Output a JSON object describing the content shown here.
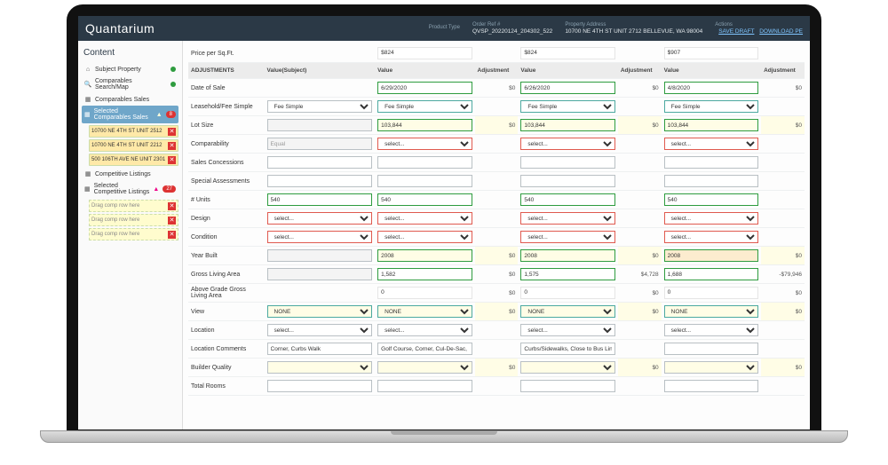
{
  "brand": "Quantarium",
  "top": {
    "product_label": "Product Type",
    "product_val": "",
    "order_label": "Order Ref #",
    "order_val": "QVSP_20220124_204302_522",
    "addr_label": "Property Address",
    "addr_val": "10700 NE 4TH ST UNIT 2712 BELLEVUE, WA 98004",
    "actions_label": "Actions",
    "save": "SAVE DRAFT",
    "download": "DOWNLOAD PE"
  },
  "sidebar": {
    "heading": "Content",
    "subject": "Subject Property",
    "search": "Comparables Search/Map",
    "comp_sales": "Comparables Sales",
    "sel_comp_sales": "Selected Comparables Sales",
    "sel_badge": "8",
    "subs": [
      "10700 NE 4TH ST UNIT 2512",
      "10700 NE 4TH ST UNIT 2212",
      "500 106TH AVE NE UNIT 2301"
    ],
    "comp_listings": "Competitive Listings",
    "sel_comp_listings": "Selected Competitive Listings",
    "sel_list_badge": "27",
    "drag_txt": "Drag comp row here"
  },
  "headers": {
    "adjustments": "ADJUSTMENTS",
    "valueSubject": "Value(Subject)",
    "value": "Value",
    "adjustment": "Adjustment"
  },
  "rows": {
    "price_psf": {
      "label": "Price per Sq.Ft.",
      "v1": "$824",
      "v2": "$824",
      "v3": "$907"
    },
    "date": {
      "label": "Date of Sale",
      "subj": "",
      "v1": "6/29/2020",
      "a1": "$0",
      "v2": "6/26/2020",
      "a2": "$0",
      "v3": "4/8/2020",
      "a3": "$0"
    },
    "lease": {
      "label": "Leasehold/Fee Simple",
      "subj": "Fee Simple",
      "v1": "Fee Simple",
      "v2": "Fee Simple",
      "v3": "Fee Simple"
    },
    "lot": {
      "label": "Lot Size",
      "subj": "",
      "v1": "103,844",
      "a1": "$0",
      "v2": "103,844",
      "a2": "$0",
      "v3": "103,844",
      "a3": "$0"
    },
    "comparability": {
      "label": "Comparability",
      "subj": "Equal",
      "v1": "select...",
      "v2": "select...",
      "v3": "select..."
    },
    "sales_conc": {
      "label": "Sales Concessions"
    },
    "special_assess": {
      "label": "Special Assessments"
    },
    "units": {
      "label": "# Units",
      "subj": "540",
      "v1": "540",
      "v2": "540",
      "v3": "540"
    },
    "design": {
      "label": "Design",
      "subj": "select...",
      "v1": "select...",
      "v2": "select...",
      "v3": "select..."
    },
    "condition": {
      "label": "Condition",
      "subj": "select...",
      "v1": "select...",
      "v2": "select...",
      "v3": "select..."
    },
    "year": {
      "label": "Year Built",
      "subj": "",
      "v1": "2008",
      "a1": "$0",
      "v2": "2008",
      "a2": "$0",
      "v3": "2008",
      "a3": "$0"
    },
    "gla": {
      "label": "Gross Living Area",
      "subj": "",
      "v1": "1,582",
      "a1": "$0",
      "v2": "1,575",
      "a2": "$4,728",
      "v3": "1,688",
      "a3": "-$79,946"
    },
    "above": {
      "label": "Above Grade Gross Living Area",
      "v1": "0",
      "a1": "$0",
      "v2": "0",
      "a2": "$0",
      "v3": "0",
      "a3": "$0"
    },
    "view": {
      "label": "View",
      "subj": "NONE",
      "v1": "NONE",
      "a1": "$0",
      "v2": "NONE",
      "a2": "$0",
      "v3": "NONE",
      "a3": "$0"
    },
    "location": {
      "label": "Location",
      "subj": "select...",
      "v1": "select...",
      "v2": "select...",
      "v3": "select..."
    },
    "loc_comments": {
      "label": "Location Comments",
      "subj": "Corner, Curbs Walk",
      "v1": "Golf Course, Corner, Cul-De-Sac, Curbs/Sidewalks",
      "v2": "Curbs/Sidewalks, Close to Bus Line",
      "v3": ""
    },
    "builder": {
      "label": "Builder Quality",
      "a1": "$0",
      "a2": "$0",
      "a3": "$0"
    },
    "total_rooms": {
      "label": "Total Rooms"
    }
  }
}
